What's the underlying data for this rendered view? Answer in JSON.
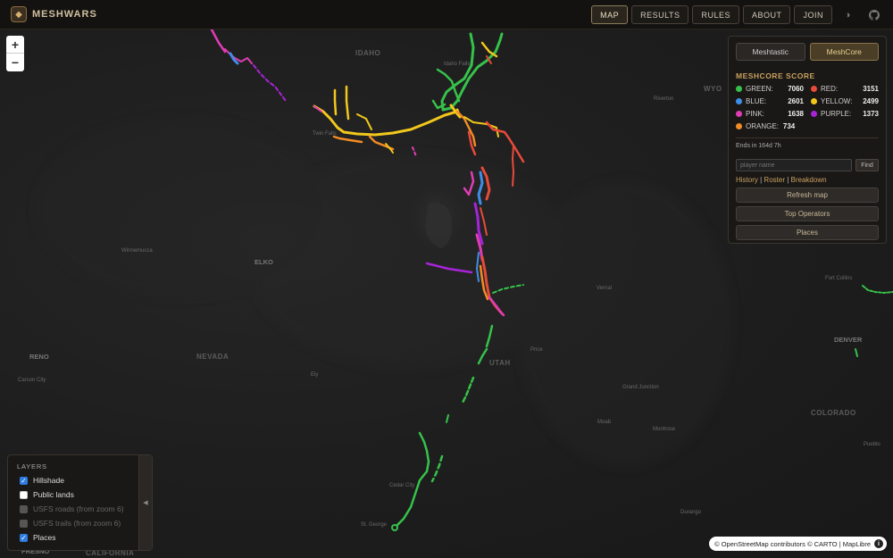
{
  "app": {
    "brand": "MESHWARS",
    "nav": [
      "MAP",
      "RESULTS",
      "RULES",
      "ABOUT",
      "JOIN"
    ],
    "active_nav": "MAP"
  },
  "score_panel": {
    "modes": [
      "Meshtastic",
      "MeshCore"
    ],
    "active_mode": "MeshCore",
    "title": "MESHCORE SCORE",
    "teams": [
      {
        "name": "GREEN:",
        "score": "7060",
        "color": "#36c24a"
      },
      {
        "name": "RED:",
        "score": "3151",
        "color": "#e84a3a"
      },
      {
        "name": "BLUE:",
        "score": "2601",
        "color": "#3f8ee8"
      },
      {
        "name": "YELLOW:",
        "score": "2499",
        "color": "#f2c81c"
      },
      {
        "name": "PINK:",
        "score": "1638",
        "color": "#e03cb4"
      },
      {
        "name": "PURPLE:",
        "score": "1373",
        "color": "#a624d8"
      },
      {
        "name": "ORANGE:",
        "score": "734",
        "color": "#f28c24"
      }
    ],
    "ends": "Ends in 164d 7h",
    "find_placeholder": "player name",
    "find_label": "Find",
    "links": [
      "History",
      "Roster",
      "Breakdown"
    ],
    "buttons": [
      "Refresh map",
      "Top Operators",
      "Places"
    ]
  },
  "layers": {
    "title": "LAYERS",
    "items": [
      {
        "label": "Hillshade",
        "state": "checked"
      },
      {
        "label": "Public lands",
        "state": "unchecked"
      },
      {
        "label": "USFS roads (from zoom 6)",
        "state": "disabled"
      },
      {
        "label": "USFS trails (from zoom 6)",
        "state": "disabled"
      },
      {
        "label": "Places",
        "state": "checked"
      }
    ]
  },
  "map_labels": {
    "idaho": "IDAHO",
    "idaho_falls": "Idaho Falls",
    "twin_falls": "Twin Falls",
    "wyoming": "WYO",
    "riverton": "Riverton",
    "winnemucca": "Winnemucca",
    "elko": "ELKO",
    "nevada": "NEVADA",
    "reno": "RENO",
    "carson_city": "Carson City",
    "ely": "Ely",
    "utah": "UTAH",
    "price": "Price",
    "vernal": "Vernal",
    "grand_junction": "Grand Junction",
    "moab": "Moab",
    "montrose": "Montrose",
    "colorado": "COLORADO",
    "denver": "DENVER",
    "fort_collins": "Fort Collins",
    "cedar_city": "Cedar City",
    "st_george": "St. George",
    "durango": "Durango",
    "pueblo": "Pueblo",
    "fresno": "FRESNO",
    "california": "CALIFORNIA"
  },
  "attribution": "© OpenStreetMap contributors © CARTO | MapLibre"
}
